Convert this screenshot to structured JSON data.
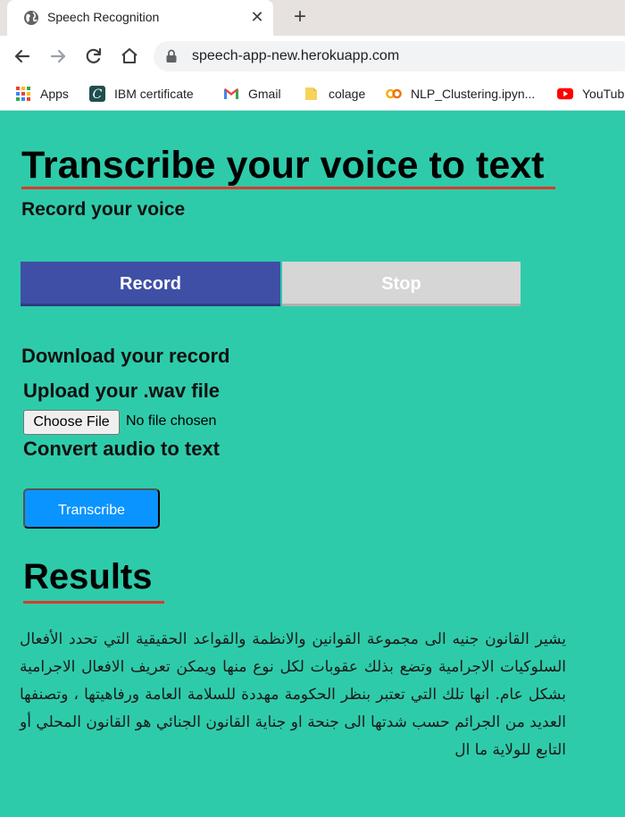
{
  "browser": {
    "tab_title": "Speech Recognition",
    "url": "speech-app-new.herokuapp.com",
    "bookmarks": [
      {
        "label": "Apps",
        "icon": "apps-grid-icon"
      },
      {
        "label": "IBM certificate",
        "icon": "coursera-icon"
      },
      {
        "label": "Gmail",
        "icon": "gmail-icon"
      },
      {
        "label": "colage",
        "icon": "folder-icon"
      },
      {
        "label": "NLP_Clustering.ipyn...",
        "icon": "colab-icon"
      },
      {
        "label": "YouTub",
        "icon": "youtube-icon"
      }
    ]
  },
  "page": {
    "title": "Transcribe your voice to text",
    "subtitle": "Record your voice",
    "record_label": "Record",
    "stop_label": "Stop",
    "download_label": "Download your record",
    "upload_label": "Upload your .wav file",
    "choose_file_label": "Choose File",
    "file_status": "No file chosen",
    "convert_label": "Convert audio to text",
    "transcribe_label": "Transcribe",
    "results_title": "Results",
    "results_text": "يشير القانون جنيه الى مجموعة القوانين والانظمة والقواعد الحقيقية التي تحدد الأفعال السلوكيات الاجرامية وتضع بذلك عقوبات لكل نوع منها ويمكن تعريف الافعال الاجرامية بشكل عام. انها تلك التي تعتبر بنظر الحكومة مهددة للسلامة العامة ورفاهيتها ، وتصنفها العديد من الجرائم حسب شدتها الى جنحة او جناية القانون الجنائي هو القانون المحلي أو التابع للولاية ما ال"
  },
  "colors": {
    "page_background": "#2ecbaa",
    "record_button": "#3f4fa5",
    "stop_button": "#d6d6d6",
    "transcribe_button": "#0a94ff",
    "title_underline": "#d93a2b"
  }
}
